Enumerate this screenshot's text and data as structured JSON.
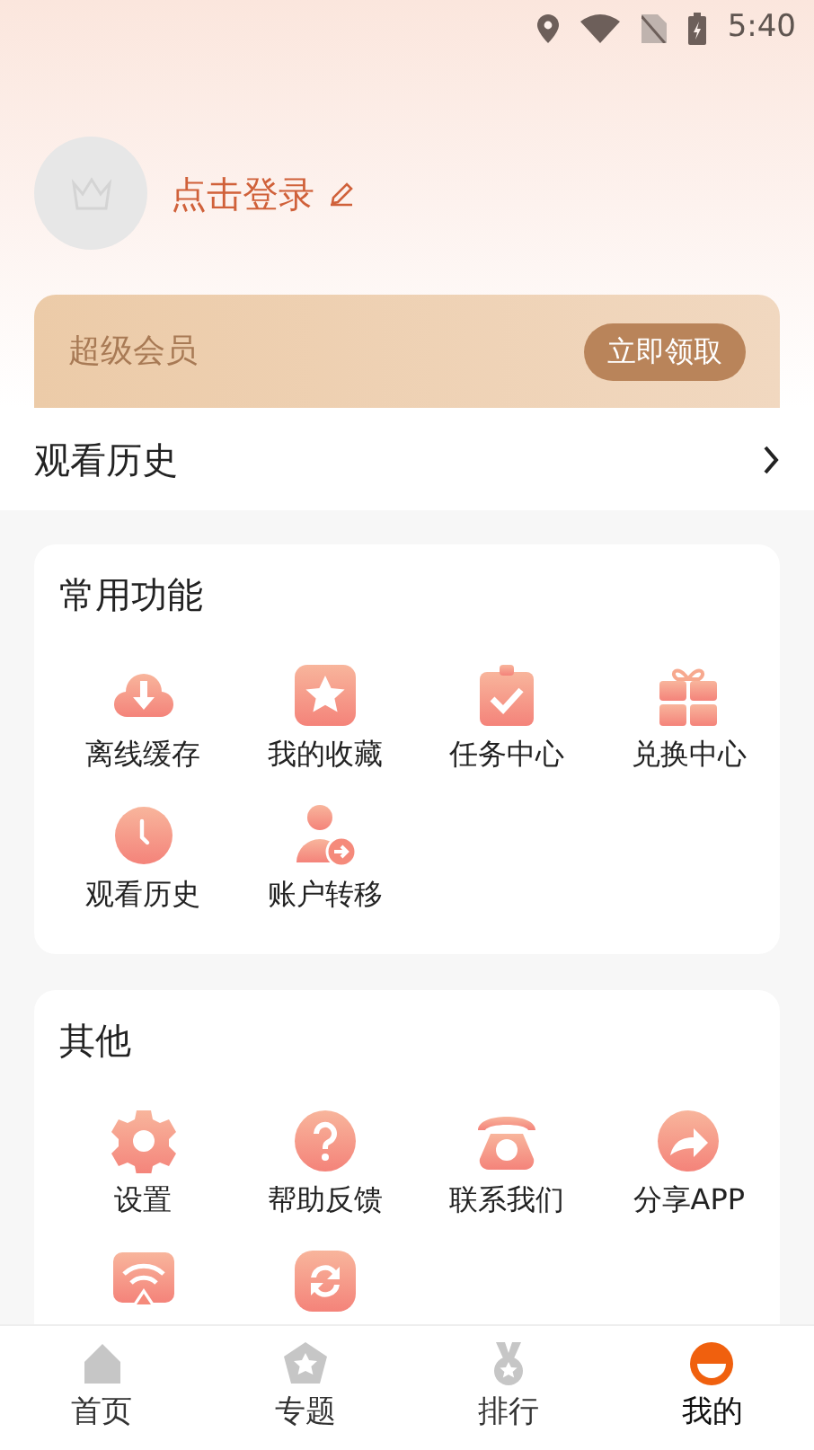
{
  "status_bar": {
    "time": "5:40"
  },
  "profile": {
    "login": "点击登录"
  },
  "vip": {
    "title": "超级会员",
    "button": "立即领取"
  },
  "history_row": {
    "label": "观看历史"
  },
  "sections": [
    {
      "title": "常用功能",
      "items": [
        {
          "kind": "full",
          "label": "离线缓存"
        },
        {
          "kind": "full",
          "label": "我的收藏"
        },
        {
          "kind": "full",
          "label": "任务中心"
        },
        {
          "kind": "full",
          "label": "兑换中心"
        },
        {
          "kind": "full",
          "label": "观看历史"
        },
        {
          "kind": "full",
          "label": "账户转移"
        }
      ]
    },
    {
      "title": "其他",
      "items": [
        {
          "kind": "full",
          "label": "设置"
        },
        {
          "kind": "full",
          "label": "帮助反馈"
        },
        {
          "kind": "full",
          "label": "联系我们"
        },
        {
          "kind": "full",
          "label": "分享APP"
        },
        {
          "kind": "truncated"
        },
        {
          "kind": "truncated"
        }
      ]
    }
  ],
  "tabs": [
    {
      "label": "首页",
      "selected": false
    },
    {
      "label": "专题",
      "selected": false
    },
    {
      "label": "排行",
      "selected": false
    },
    {
      "label": "我的",
      "selected": true
    }
  ]
}
